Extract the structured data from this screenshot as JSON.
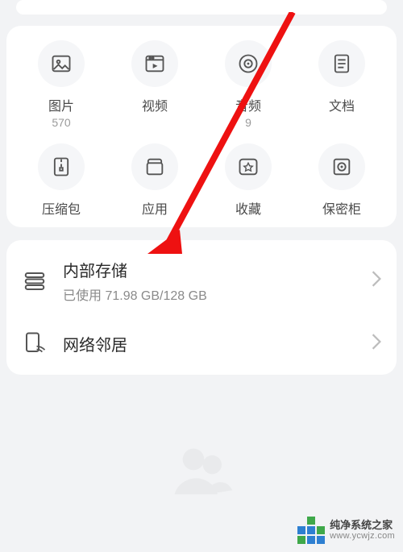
{
  "grid": [
    {
      "key": "images",
      "label": "图片",
      "count": "570"
    },
    {
      "key": "videos",
      "label": "视频",
      "count": ""
    },
    {
      "key": "audio",
      "label": "音频",
      "count": "9"
    },
    {
      "key": "docs",
      "label": "文档",
      "count": ""
    },
    {
      "key": "archives",
      "label": "压缩包",
      "count": ""
    },
    {
      "key": "apps",
      "label": "应用",
      "count": ""
    },
    {
      "key": "fav",
      "label": "收藏",
      "count": ""
    },
    {
      "key": "vault",
      "label": "保密柜",
      "count": ""
    }
  ],
  "storage": {
    "title": "内部存储",
    "subtitle": "已使用 71.98 GB/128 GB"
  },
  "network": {
    "title": "网络邻居"
  },
  "watermark": {
    "name": "纯净系统之家",
    "url": "www.ycwjz.com"
  }
}
